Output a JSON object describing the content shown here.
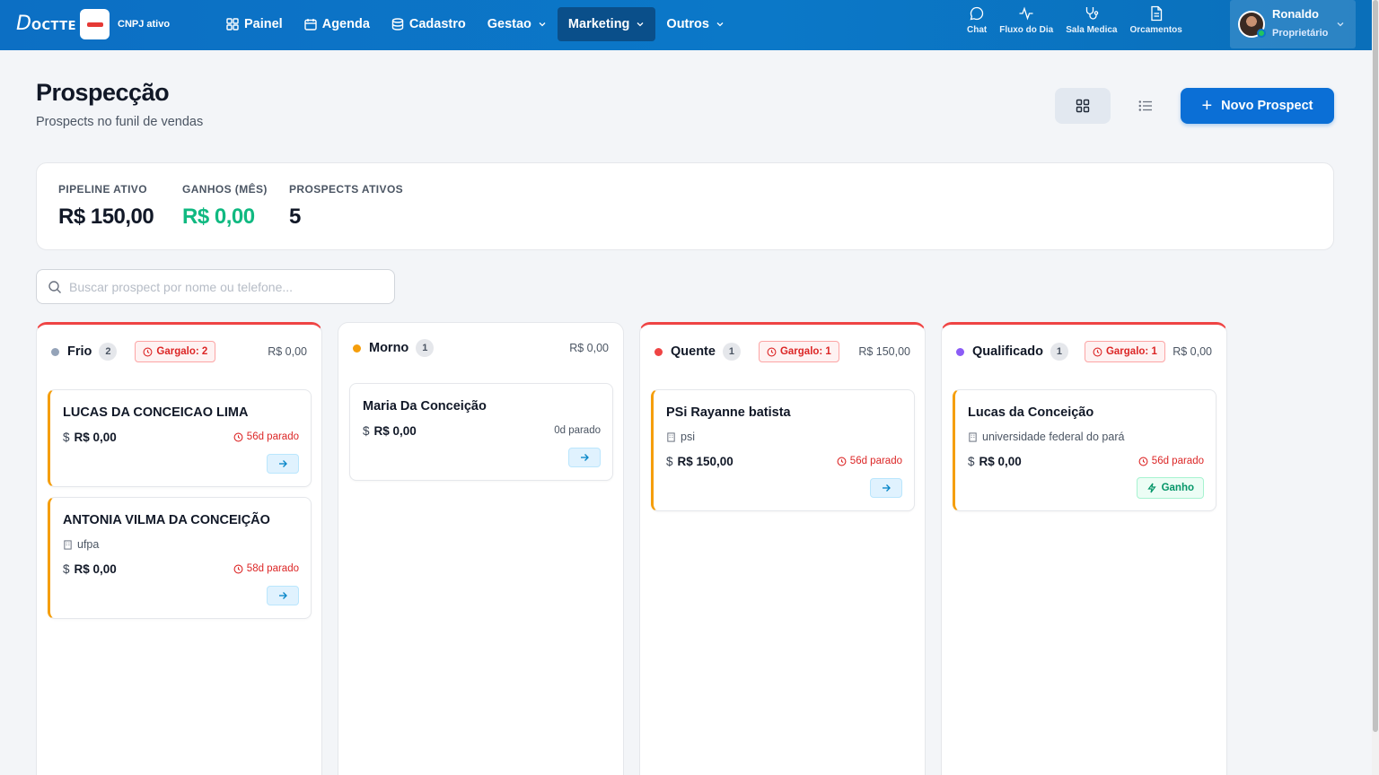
{
  "topbar": {
    "logo_d": "D",
    "logo_rest": "OCTTE",
    "cnpj": "CNPJ ativo",
    "nav": [
      {
        "label": "Painel",
        "icon": "grid-icon"
      },
      {
        "label": "Agenda",
        "icon": "calendar-icon"
      },
      {
        "label": "Cadastro",
        "icon": "database-icon"
      },
      {
        "label": "Gestao",
        "icon": "chevron-down-icon"
      },
      {
        "label": "Marketing",
        "icon": "chevron-down-icon",
        "active": true
      },
      {
        "label": "Outros",
        "icon": "chevron-down-icon"
      }
    ],
    "quick": [
      {
        "label": "Chat",
        "icon": "chat-icon"
      },
      {
        "label": "Fluxo do Dia",
        "icon": "activity-icon"
      },
      {
        "label": "Sala Medica",
        "icon": "stethoscope-icon"
      },
      {
        "label": "Orcamentos",
        "icon": "document-icon"
      }
    ],
    "user": {
      "name": "Ronaldo",
      "role": "Proprietário"
    }
  },
  "page": {
    "title": "Prospecção",
    "subtitle": "Prospects no funil de vendas",
    "new_button": "Novo Prospect"
  },
  "stats": [
    {
      "label": "PIPELINE ATIVO",
      "value": "R$ 150,00"
    },
    {
      "label": "GANHOS (MÊS)",
      "value": "R$ 0,00"
    },
    {
      "label": "PROSPECTS ATIVOS",
      "value": "5"
    }
  ],
  "search": {
    "placeholder": "Buscar prospect por nome ou telefone..."
  },
  "columns": [
    {
      "name": "Frio",
      "count": "2",
      "gargalo": "Gargalo: 2",
      "total": "R$ 0,00",
      "cards": [
        {
          "name": "LUCAS DA CONCEICAO LIMA",
          "value": "R$ 0,00",
          "stale": "56d parado"
        },
        {
          "name": "ANTONIA VILMA DA CONCEIÇÃO",
          "org": "ufpa",
          "value": "R$ 0,00",
          "stale": "58d parado"
        }
      ]
    },
    {
      "name": "Morno",
      "count": "1",
      "total": "R$ 0,00",
      "cards": [
        {
          "name": "Maria Da Conceição",
          "value": "R$ 0,00",
          "stale": "0d parado"
        }
      ]
    },
    {
      "name": "Quente",
      "count": "1",
      "gargalo": "Gargalo: 1",
      "total": "R$ 150,00",
      "cards": [
        {
          "name": "PSi Rayanne batista",
          "org": "psi",
          "value": "R$ 150,00",
          "stale": "56d parado"
        }
      ]
    },
    {
      "name": "Qualificado",
      "count": "1",
      "gargalo": "Gargalo: 1",
      "total": "R$ 0,00",
      "cards": [
        {
          "name": "Lucas da Conceição",
          "org": "universidade federal do pará",
          "value": "R$ 0,00",
          "stale": "56d parado",
          "action": "Ganho"
        }
      ]
    }
  ],
  "currency_symbol": "$",
  "colors": {
    "topbar": "#0b78c8",
    "primary": "#0b6fd6",
    "success": "#10b981",
    "danger": "#ef4444",
    "frio": "#94a3b8",
    "morno": "#f59e0b",
    "quente": "#ef4444",
    "qualificado": "#8b5cf6"
  }
}
